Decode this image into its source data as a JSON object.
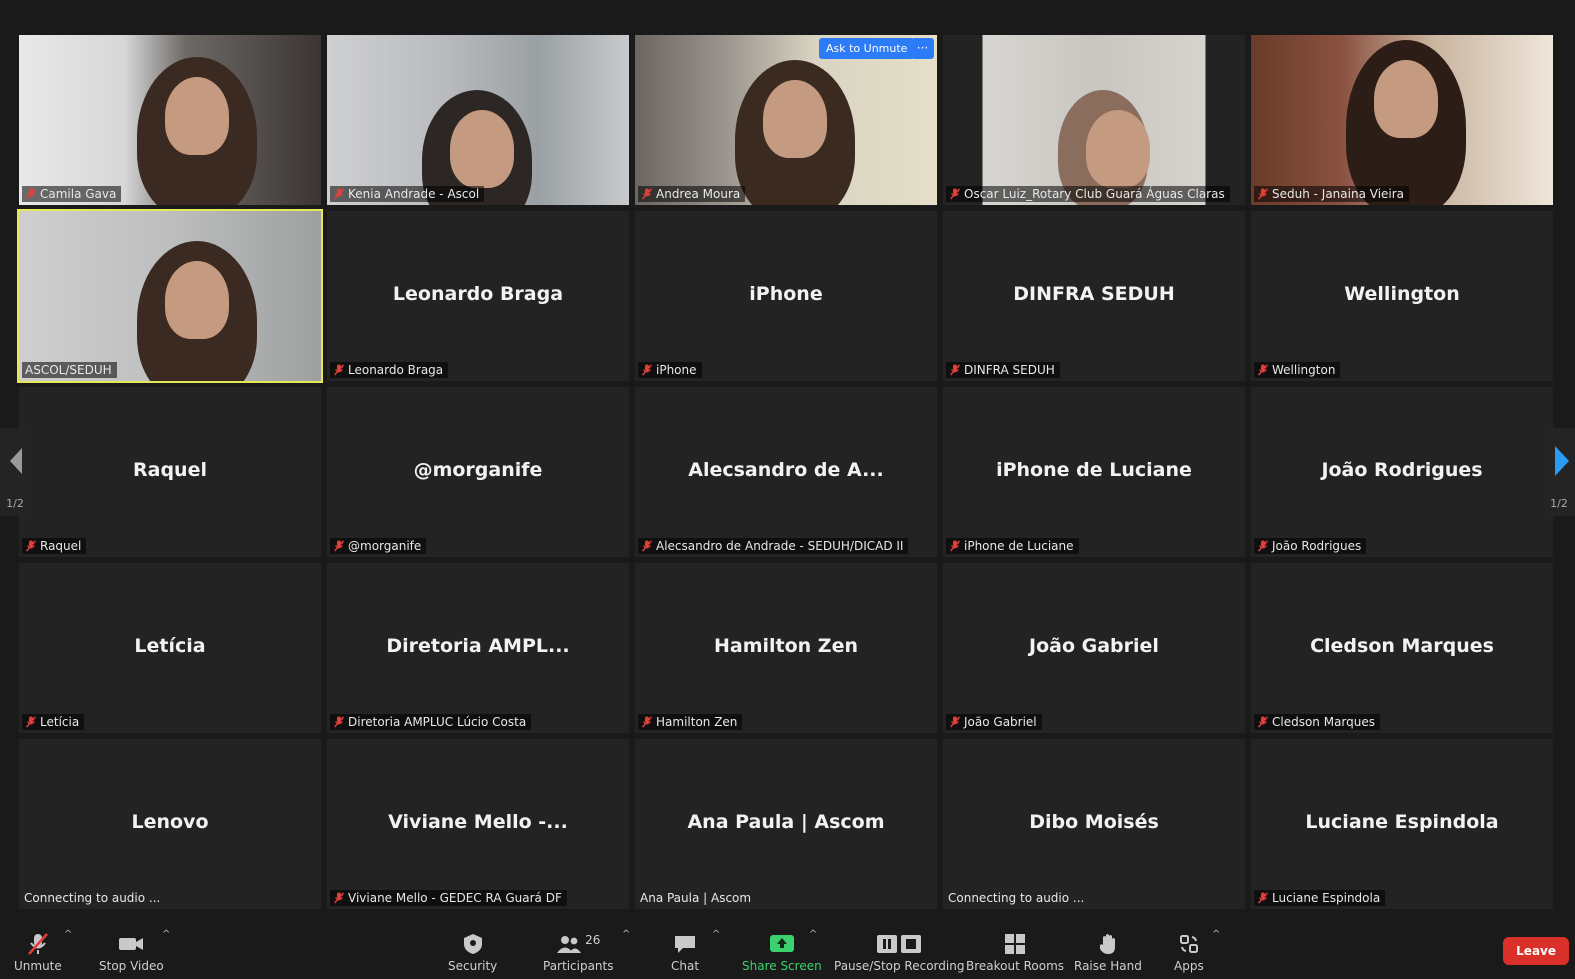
{
  "video_tiles": [
    {
      "label": "Camila Gava",
      "muted": true
    },
    {
      "label": "Kenia Andrade - Ascol",
      "muted": true
    },
    {
      "label": "Andrea Moura",
      "muted": true
    },
    {
      "label": "Oscar Luiz_Rotary Club Guará Águas Claras",
      "muted": true
    },
    {
      "label": "Seduh - Janaina Vieira",
      "muted": true
    },
    {
      "label": "ASCOL/SEDUH",
      "muted": false,
      "active": true
    }
  ],
  "name_tiles": [
    {
      "name": "Leonardo Braga",
      "label": "Leonardo Braga",
      "muted": true
    },
    {
      "name": "iPhone",
      "label": "iPhone",
      "muted": true
    },
    {
      "name": "DINFRA SEDUH",
      "label": "DINFRA SEDUH",
      "muted": true
    },
    {
      "name": "Wellington",
      "label": "Wellington",
      "muted": true
    },
    {
      "name": "Raquel",
      "label": "Raquel",
      "muted": true
    },
    {
      "name": "@morganife",
      "label": "@morganife",
      "muted": true
    },
    {
      "name": "Alecsandro de A...",
      "label": "Alecsandro de Andrade - SEDUH/DICAD II",
      "muted": true
    },
    {
      "name": "iPhone de Luciane",
      "label": "iPhone de Luciane",
      "muted": true
    },
    {
      "name": "João Rodrigues",
      "label": "João Rodrigues",
      "muted": true
    },
    {
      "name": "Letícia",
      "label": "Letícia",
      "muted": true
    },
    {
      "name": "Diretoria  AMPL...",
      "label": "Diretoria AMPLUC Lúcio Costa",
      "muted": true
    },
    {
      "name": "Hamilton Zen",
      "label": "Hamilton Zen",
      "muted": true
    },
    {
      "name": "João Gabriel",
      "label": "João Gabriel",
      "muted": true
    },
    {
      "name": "Cledson Marques",
      "label": "Cledson Marques",
      "muted": true
    },
    {
      "name": "Lenovo",
      "label": "Connecting to audio ...",
      "muted": false
    },
    {
      "name": "Viviane Mello -...",
      "label": "Viviane Mello - GEDEC RA Guará DF",
      "muted": true
    },
    {
      "name": "Ana Paula | Ascom",
      "label": "Ana Paula | Ascom",
      "muted": false
    },
    {
      "name": "Dibo Moisés",
      "label": "Connecting to audio ...",
      "muted": false
    },
    {
      "name": "Luciane Espindola",
      "label": "Luciane Espindola",
      "muted": true
    }
  ],
  "ask_to_unmute": "Ask to Unmute",
  "more_button": "···",
  "pagination": {
    "left": "1/2",
    "right": "1/2"
  },
  "toolbar": {
    "unmute": "Unmute",
    "stop_video": "Stop Video",
    "security": "Security",
    "participants": "Participants",
    "participants_count": "26",
    "chat": "Chat",
    "share_screen": "Share Screen",
    "recording": "Pause/Stop Recording",
    "breakout_rooms": "Breakout Rooms",
    "raise_hand": "Raise Hand",
    "apps": "Apps",
    "leave": "Leave"
  },
  "colors": {
    "background": "#1a1a1a",
    "tile": "#232323",
    "active_outline": "#e6e85a",
    "mute_red": "#e2403a",
    "accent_blue": "#2b7cf6",
    "share_green": "#3bd16f",
    "leave_red": "#d9312a"
  }
}
